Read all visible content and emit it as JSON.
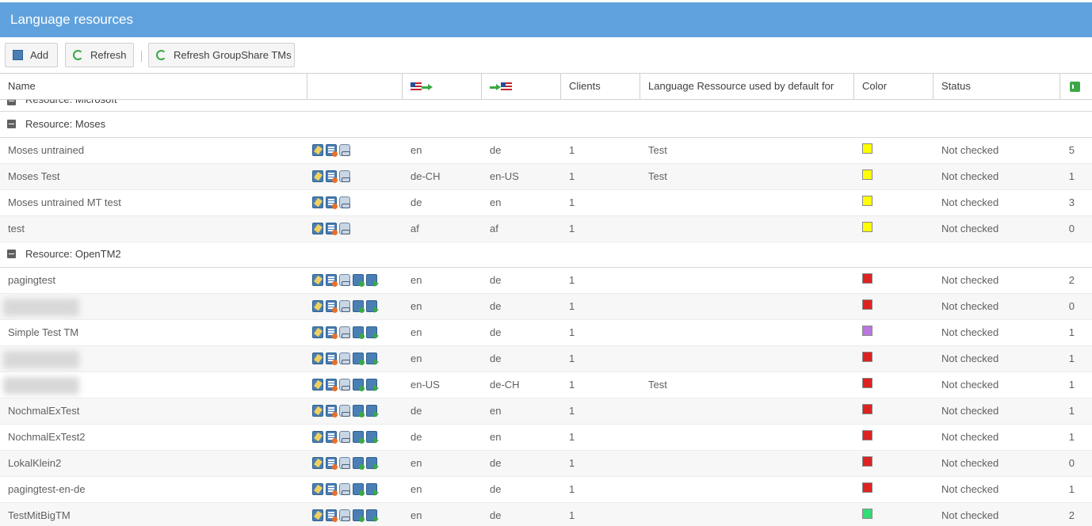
{
  "window": {
    "title": "Language resources"
  },
  "toolbar": {
    "add_label": "Add",
    "refresh_label": "Refresh",
    "refresh_groupshare_label": "Refresh GroupShare TMs"
  },
  "columns": {
    "name": "Name",
    "actions": "",
    "clients": "Clients",
    "default_for": "Language Ressource used by default for",
    "color": "Color",
    "status": "Status"
  },
  "groups": [
    {
      "title": "Resource: Microsoft"
    },
    {
      "title": "Resource: Moses"
    },
    {
      "title": "Resource: OpenTM2"
    }
  ],
  "rows": [
    {
      "name": "Moses untrained",
      "source": "en",
      "target": "de",
      "clients": "1",
      "default_for": "Test",
      "color": "#ffff00",
      "status": "Not checked",
      "count": "5"
    },
    {
      "name": "Moses Test",
      "source": "de-CH",
      "target": "en-US",
      "clients": "1",
      "default_for": "Test",
      "color": "#ffff00",
      "status": "Not checked",
      "count": "1"
    },
    {
      "name": "Moses untrained MT test",
      "source": "de",
      "target": "en",
      "clients": "1",
      "default_for": "",
      "color": "#ffff00",
      "status": "Not checked",
      "count": "3"
    },
    {
      "name": "test",
      "source": "af",
      "target": "af",
      "clients": "1",
      "default_for": "",
      "color": "#ffff00",
      "status": "Not checked",
      "count": "0"
    },
    {
      "name": "pagingtest",
      "source": "en",
      "target": "de",
      "clients": "1",
      "default_for": "",
      "color": "#dd2222",
      "status": "Not checked",
      "count": "2"
    },
    {
      "name": "",
      "source": "en",
      "target": "de",
      "clients": "1",
      "default_for": "",
      "color": "#dd2222",
      "status": "Not checked",
      "count": "0"
    },
    {
      "name": "Simple Test TM",
      "source": "en",
      "target": "de",
      "clients": "1",
      "default_for": "",
      "color": "#bb77dd",
      "status": "Not checked",
      "count": "1"
    },
    {
      "name": "",
      "source": "en",
      "target": "de",
      "clients": "1",
      "default_for": "",
      "color": "#dd2222",
      "status": "Not checked",
      "count": "1"
    },
    {
      "name": "",
      "source": "en-US",
      "target": "de-CH",
      "clients": "1",
      "default_for": "Test",
      "color": "#dd2222",
      "status": "Not checked",
      "count": "1"
    },
    {
      "name": "NochmalExTest",
      "source": "de",
      "target": "en",
      "clients": "1",
      "default_for": "",
      "color": "#dd2222",
      "status": "Not checked",
      "count": "1"
    },
    {
      "name": "NochmalExTest2",
      "source": "de",
      "target": "en",
      "clients": "1",
      "default_for": "",
      "color": "#dd2222",
      "status": "Not checked",
      "count": "1"
    },
    {
      "name": "LokalKlein2",
      "source": "en",
      "target": "de",
      "clients": "1",
      "default_for": "",
      "color": "#dd2222",
      "status": "Not checked",
      "count": "0"
    },
    {
      "name": "pagingtest-en-de",
      "source": "en",
      "target": "de",
      "clients": "1",
      "default_for": "",
      "color": "#dd2222",
      "status": "Not checked",
      "count": "1"
    },
    {
      "name": "TestMitBigTM",
      "source": "en",
      "target": "de",
      "clients": "1",
      "default_for": "",
      "color": "#33dd77",
      "status": "Not checked",
      "count": "2"
    }
  ]
}
